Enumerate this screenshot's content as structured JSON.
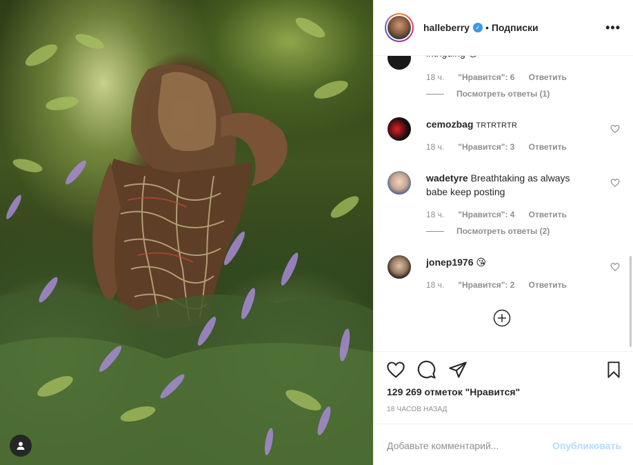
{
  "post": {
    "username": "halleberry",
    "separator": "•",
    "follow_label": "Подписки",
    "more_label": "•••"
  },
  "comments": [
    {
      "partial_text": "intriguing",
      "emoji": "😏",
      "time": "18 ч.",
      "likes": "\"Нравится\": 6",
      "reply": "Ответить",
      "view_replies": "Посмотреть ответы (1)"
    },
    {
      "username": "cemozbag",
      "text": "TRTRTRTR",
      "time": "18 ч.",
      "likes": "\"Нравится\": 3",
      "reply": "Ответить"
    },
    {
      "username": "wadetyre",
      "text": "Breathtaking as always babe keep posting",
      "time": "18 ч.",
      "likes": "\"Нравится\": 4",
      "reply": "Ответить",
      "view_replies": "Посмотреть ответы (2)"
    },
    {
      "username": "jonep1976",
      "text": "😘",
      "time": "18 ч.",
      "likes": "\"Нравится\": 2",
      "reply": "Ответить"
    }
  ],
  "footer": {
    "likes_count": "129 269 отметок \"Нравится\"",
    "posted_ago": "18 ЧАСОВ НАЗАД",
    "comment_placeholder": "Добавьте комментарий...",
    "publish_label": "Опубликовать"
  },
  "colors": {
    "accent": "#3897f0",
    "publish_disabled": "#b3dbff",
    "meta_gray": "#8e8e8e"
  }
}
